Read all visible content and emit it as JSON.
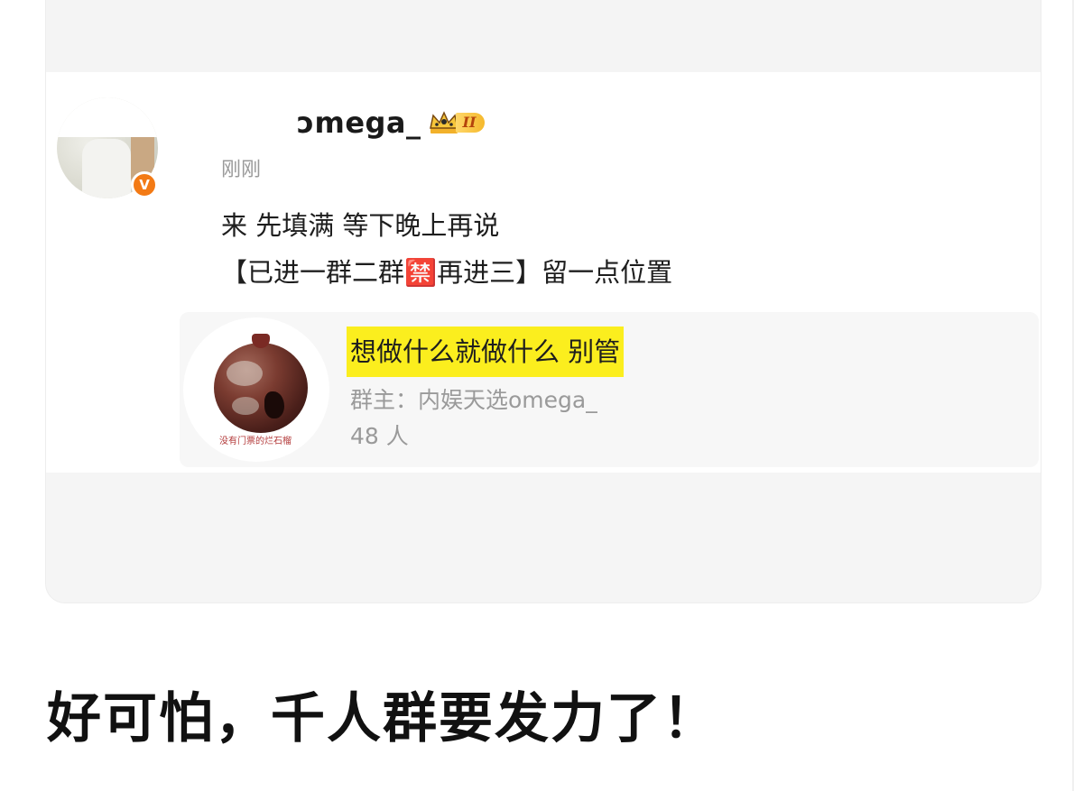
{
  "post": {
    "username": "ɔmega_",
    "vip_level": "II",
    "time": "刚刚",
    "verified_mark": "V",
    "lines": [
      "来 先填满 等下晚上再说",
      "【已进一群二群🈲再进三】留一点位置"
    ]
  },
  "group": {
    "thumb_caption": "没有门票的烂石榴",
    "name": "想做什么就做什么 别管",
    "owner": "群主：内娱天选omega_",
    "member_count": "48 人"
  },
  "caption": "好可怕，千人群要发力了！",
  "colors": {
    "highlight": "#fbee1e",
    "verified_orange": "#f37a15",
    "vip_gold": "#f5b92c",
    "muted_text": "#9a9a9a"
  },
  "icons": {
    "vip": "crown-icon",
    "verified": "verified-v-icon"
  }
}
